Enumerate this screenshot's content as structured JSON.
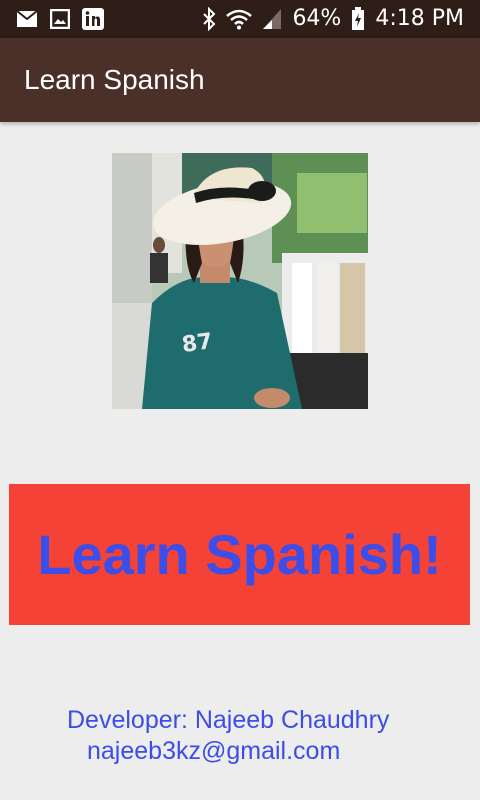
{
  "status_bar": {
    "battery": "64%",
    "time": "4:18 PM",
    "icons": [
      "mail-icon",
      "image-icon",
      "linkedin-icon",
      "bluetooth-icon",
      "wifi-icon",
      "signal-icon",
      "battery-icon"
    ]
  },
  "app_bar": {
    "title": "Learn Spanish"
  },
  "main": {
    "cta_label": "Learn Spanish!",
    "developer_line": "Developer: Najeeb Chaudhry",
    "email": "najeeb3kz@gmail.com"
  },
  "colors": {
    "status_bar_bg": "#2f1d17",
    "app_bar_bg": "#4a3028",
    "cta_bg": "#f44336",
    "cta_text": "#3c4de8",
    "dev_text": "#3c4de8",
    "background": "#ededed"
  }
}
